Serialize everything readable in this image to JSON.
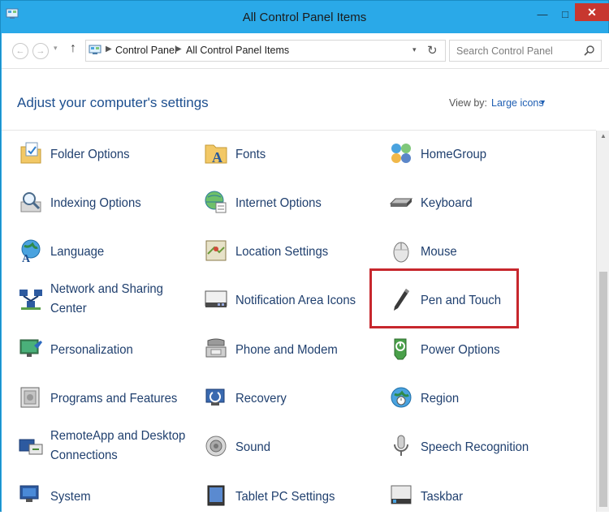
{
  "window": {
    "title": "All Control Panel Items",
    "controls": {
      "minimize": "—",
      "maximize": "□",
      "close": "✕"
    }
  },
  "toolbar": {
    "back_icon": "←",
    "forward_icon": "→",
    "recent_icon": "▾",
    "up_icon": "↑",
    "breadcrumbs": [
      "Control Panel",
      "All Control Panel Items"
    ],
    "separator": "▶",
    "dropdown_icon": "▾",
    "refresh_icon": "↻",
    "search_placeholder": "Search Control Panel"
  },
  "content": {
    "heading": "Adjust your computer's settings",
    "view_by_label": "View by:",
    "view_by_value": "Large icons",
    "view_by_caret": "▼"
  },
  "items": [
    {
      "label": "Folder Options",
      "icon": "folder-options-icon"
    },
    {
      "label": "Fonts",
      "icon": "fonts-icon"
    },
    {
      "label": "HomeGroup",
      "icon": "homegroup-icon"
    },
    {
      "label": "Indexing Options",
      "icon": "indexing-options-icon"
    },
    {
      "label": "Internet Options",
      "icon": "internet-options-icon"
    },
    {
      "label": "Keyboard",
      "icon": "keyboard-icon"
    },
    {
      "label": "Language",
      "icon": "language-icon"
    },
    {
      "label": "Location Settings",
      "icon": "location-settings-icon"
    },
    {
      "label": "Mouse",
      "icon": "mouse-icon"
    },
    {
      "label": "Network and Sharing Center",
      "icon": "network-sharing-icon"
    },
    {
      "label": "Notification Area Icons",
      "icon": "notification-area-icon"
    },
    {
      "label": "Pen and Touch",
      "icon": "pen-touch-icon",
      "highlighted": true
    },
    {
      "label": "Personalization",
      "icon": "personalization-icon"
    },
    {
      "label": "Phone and Modem",
      "icon": "phone-modem-icon"
    },
    {
      "label": "Power Options",
      "icon": "power-options-icon"
    },
    {
      "label": "Programs and Features",
      "icon": "programs-features-icon"
    },
    {
      "label": "Recovery",
      "icon": "recovery-icon"
    },
    {
      "label": "Region",
      "icon": "region-icon"
    },
    {
      "label": "RemoteApp and Desktop Connections",
      "icon": "remoteapp-icon"
    },
    {
      "label": "Sound",
      "icon": "sound-icon"
    },
    {
      "label": "Speech Recognition",
      "icon": "speech-recognition-icon"
    },
    {
      "label": "System",
      "icon": "system-icon"
    },
    {
      "label": "Tablet PC Settings",
      "icon": "tablet-pc-icon"
    },
    {
      "label": "Taskbar",
      "icon": "taskbar-icon"
    }
  ],
  "colors": {
    "titlebar": "#2aa9e8",
    "close_button": "#c7372f",
    "link_text": "#1f3f6e",
    "heading": "#1d4f8f",
    "highlight_border": "#c7272d"
  }
}
